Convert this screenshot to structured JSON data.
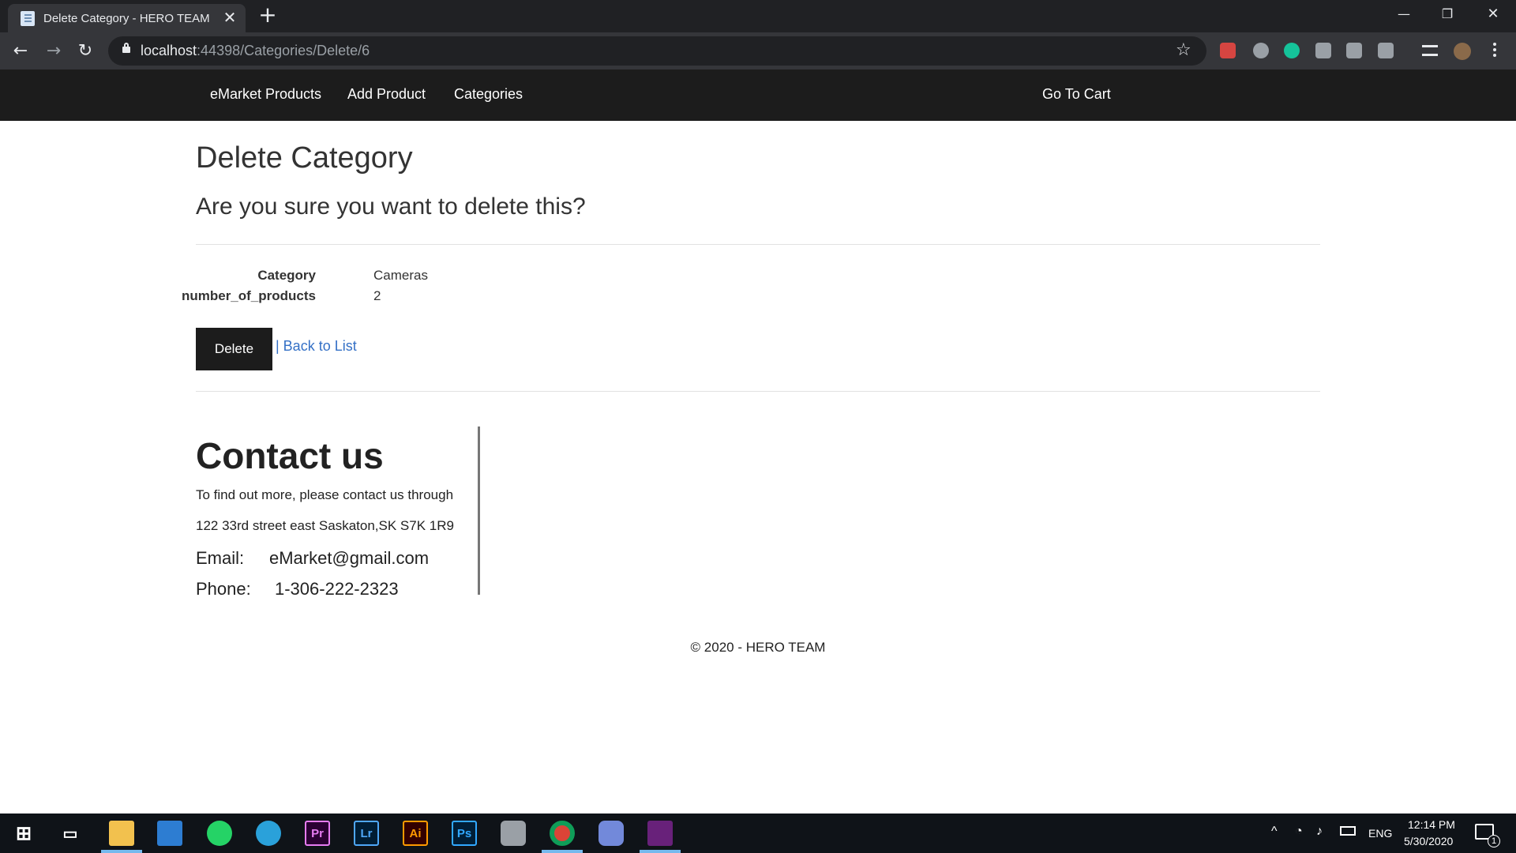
{
  "browser": {
    "tab_title": "Delete Category - HERO TEAM",
    "url_host": "localhost",
    "url_path": ":44398/Categories/Delete/6"
  },
  "nav": {
    "links": [
      "eMarket Products",
      "Add Product",
      "Categories"
    ],
    "cart": "Go To Cart"
  },
  "page": {
    "title": "Delete Category",
    "subtitle": "Are you sure you want to delete this?",
    "fields": [
      {
        "label": "Category",
        "value": "Cameras"
      },
      {
        "label": "number_of_products",
        "value": "2"
      }
    ],
    "delete_label": "Delete",
    "back_label": "| Back to List"
  },
  "contact": {
    "title": "Contact us",
    "line1": "To find out more, please contact us through",
    "address": "122 33rd street east Saskaton,SK S7K 1R9",
    "email_label": "Email:",
    "email": "eMarket@gmail.com",
    "phone_label": "Phone:",
    "phone": "1-306-222-2323"
  },
  "footer": {
    "copyright": "© 2020 - HERO TEAM"
  },
  "taskbar": {
    "language": "ENG",
    "time": "12:14 PM",
    "date": "5/30/2020",
    "notification_count": "1"
  },
  "colors": {
    "nav_bg": "#1c1c1c",
    "link": "#3470c6",
    "chrome_dark": "#202124"
  }
}
